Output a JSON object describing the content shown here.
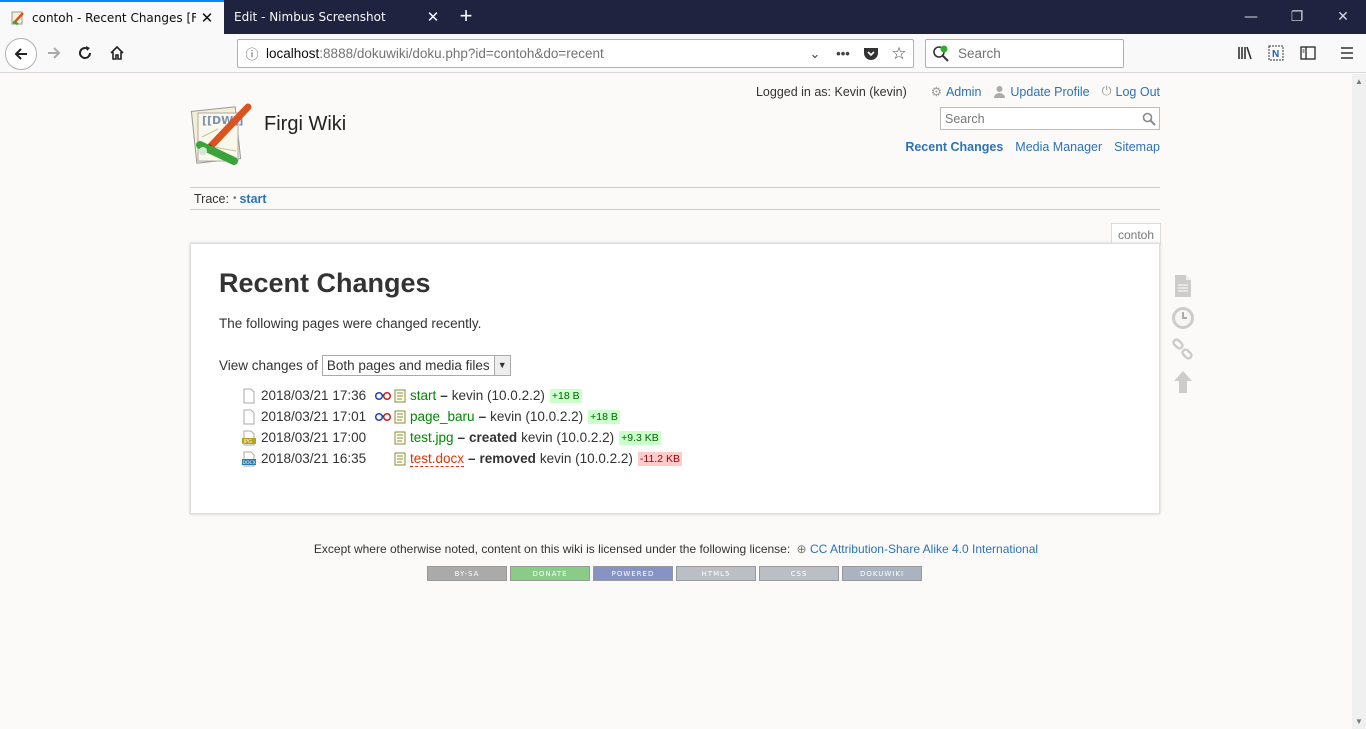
{
  "browser": {
    "tabs": [
      {
        "title": "contoh - Recent Changes [Firgi",
        "active": true
      },
      {
        "title": "Edit - Nimbus Screenshot",
        "active": false
      }
    ],
    "url_host": "localhost",
    "url_rest": ":8888/dokuwiki/doku.php?id=contoh&do=recent",
    "search_placeholder": "Search"
  },
  "wiki": {
    "title": "Firgi Wiki",
    "logged_in": "Logged in as: Kevin (kevin)",
    "user_tools": [
      "Admin",
      "Update Profile",
      "Log Out"
    ],
    "search_placeholder": "Search",
    "site_tools": [
      "Recent Changes",
      "Media Manager",
      "Sitemap"
    ],
    "trace_label": "Trace:",
    "trace_sep": "•",
    "trace_link": "start",
    "page_id": "contoh"
  },
  "content": {
    "heading": "Recent Changes",
    "intro": "The following pages were changed recently.",
    "view_label": "View changes of",
    "view_value": "Both pages and media files",
    "changes": [
      {
        "date": "2018/03/21 17:36",
        "page": "start",
        "summary": "",
        "dash": "–",
        "user": "kevin (10.0.2.2)",
        "size": "+18 B",
        "sign": "pos",
        "type": "page",
        "diff": true
      },
      {
        "date": "2018/03/21 17:01",
        "page": "page_baru",
        "summary": "",
        "dash": "–",
        "user": "kevin (10.0.2.2)",
        "size": "+18 B",
        "sign": "pos",
        "type": "page",
        "diff": true
      },
      {
        "date": "2018/03/21 17:00",
        "page": "test.jpg",
        "summary": "created",
        "dash": "–",
        "user": "kevin (10.0.2.2)",
        "size": "+9.3 KB",
        "sign": "pos",
        "type": "jpg",
        "diff": false
      },
      {
        "date": "2018/03/21 16:35",
        "page": "test.docx",
        "summary": "removed",
        "dash": "–",
        "user": "kevin (10.0.2.2)",
        "size": "-11.2 KB",
        "sign": "neg",
        "type": "docx",
        "diff": false
      }
    ]
  },
  "footer": {
    "license_text": "Except where otherwise noted, content on this wiki is licensed under the following license:",
    "license_link": "CC Attribution-Share Alike 4.0 International",
    "badges": [
      {
        "label": "BY-SA",
        "color": "#aaa"
      },
      {
        "label": "DONATE",
        "color": "#8c8"
      },
      {
        "label": "POWERED",
        "color": "#8793c5"
      },
      {
        "label": "HTML5",
        "color": "#b9bfc4"
      },
      {
        "label": "CSS",
        "color": "#b9bfc4"
      },
      {
        "label": "DOKUWIKI",
        "color": "#a9b4c0"
      }
    ]
  }
}
